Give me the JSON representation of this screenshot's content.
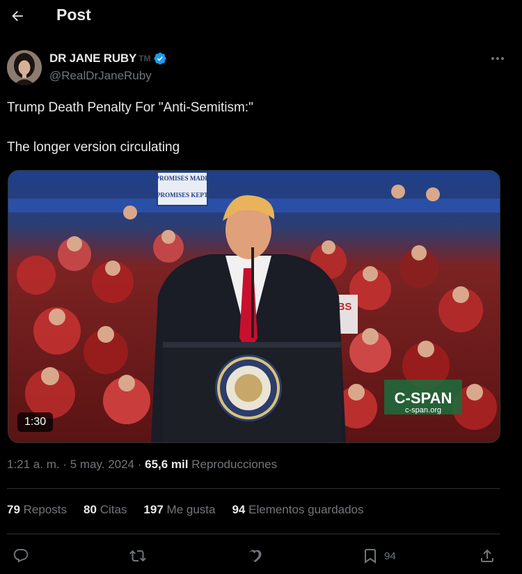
{
  "header": {
    "title": "Post"
  },
  "author": {
    "display_name": "DR JANE RUBY",
    "tm": "TM",
    "handle": "@RealDrJaneRuby"
  },
  "tweet": {
    "line1": "Trump Death Penalty For \"Anti-Semitism:\"",
    "line2": "The longer version circulating"
  },
  "media": {
    "duration": "1:30",
    "sign_top": "PROMISES MADE",
    "sign_bottom": "PROMISES KEPT",
    "sign_jobs": "JOBS",
    "watermark_title": "C-SPAN",
    "watermark_url": "c-span.org"
  },
  "meta": {
    "time": "1:21 a. m.",
    "sep1": " · ",
    "date": "5 may. 2024",
    "sep2": " · ",
    "views": "65,6 mil",
    "views_label": "Reproducciones"
  },
  "stats": {
    "reposts_count": "79",
    "reposts_label": "Reposts",
    "quotes_count": "80",
    "quotes_label": "Citas",
    "likes_count": "197",
    "likes_label": "Me gusta",
    "bookmarks_count": "94",
    "bookmarks_label": "Elementos guardados"
  },
  "actions": {
    "bookmark_count": "94"
  },
  "colors": {
    "accent": "#1d9bf0",
    "muted": "#71767b",
    "divider": "#2f3336"
  }
}
